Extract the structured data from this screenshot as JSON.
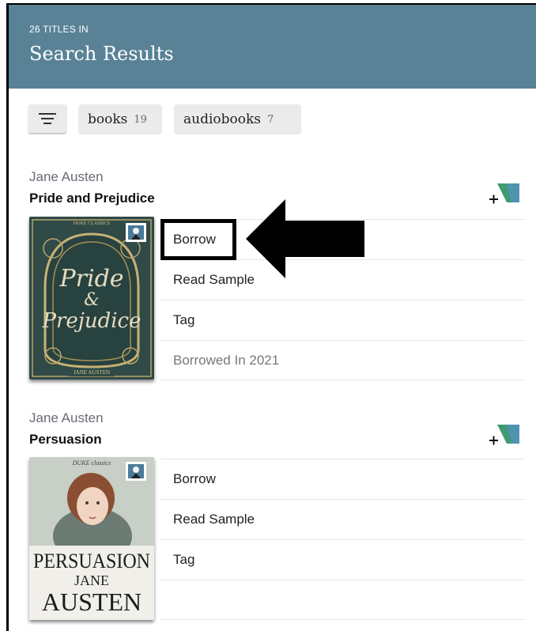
{
  "header": {
    "count": "26 TITLES IN",
    "title": "Search Results",
    "color": "#5a8296"
  },
  "filters": {
    "filter_icon": "filter-lines-icon",
    "chips": [
      {
        "label": "books",
        "count": "19"
      },
      {
        "label": "audiobooks",
        "count": "7"
      }
    ]
  },
  "results": [
    {
      "author": "Jane Austen",
      "title": "Pride and Prejudice",
      "cover": {
        "publisher": "DUKE CLASSICS",
        "line1": "Pride",
        "line2": "&",
        "line3": "Prejudice",
        "byline": "JANE AUSTEN"
      },
      "actions": [
        "Borrow",
        "Read Sample",
        "Tag",
        "Borrowed In 2021"
      ]
    },
    {
      "author": "Jane Austen",
      "title": "Persuasion",
      "cover": {
        "publisher": "DUKE classics",
        "title": "PERSUASION",
        "author1": "JANE",
        "author2": "AUSTEN"
      },
      "actions": [
        "Borrow",
        "Read Sample",
        "Tag"
      ]
    }
  ],
  "annotation": {
    "icon": "left-arrow-icon",
    "highlighted_action": "Borrow"
  }
}
